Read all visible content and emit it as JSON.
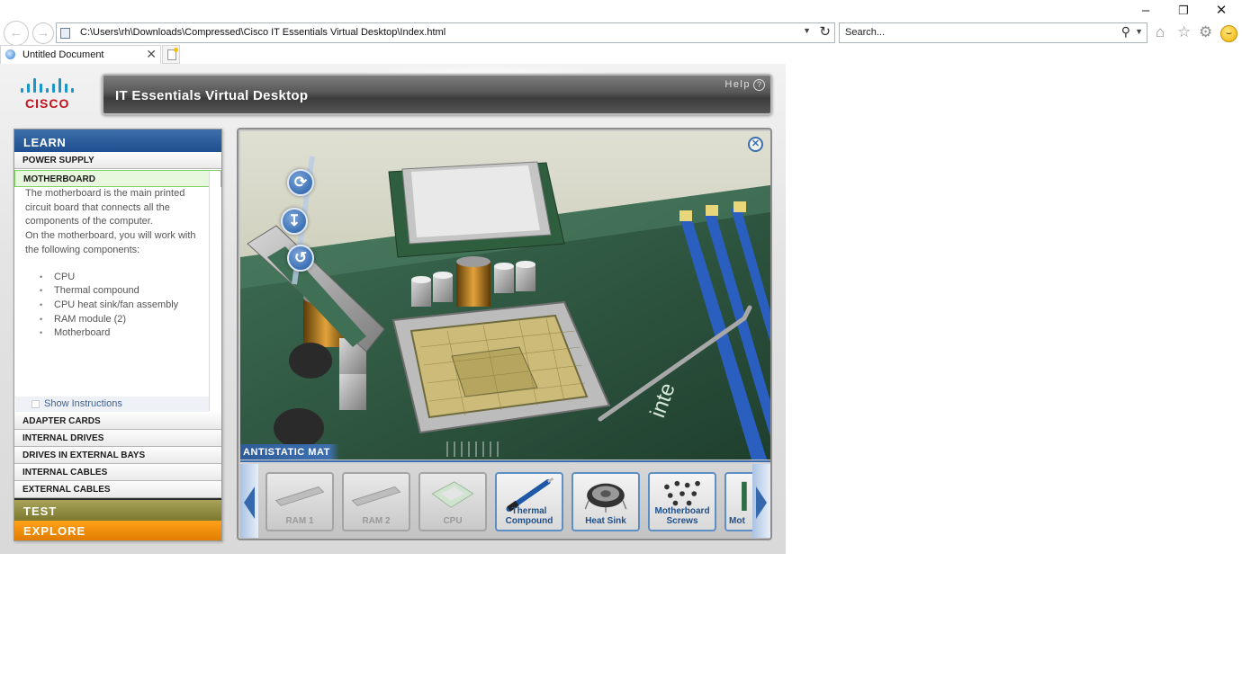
{
  "browser": {
    "address": "C:\\Users\\rh\\Downloads\\Compressed\\Cisco IT Essentials Virtual Desktop\\Index.html",
    "search_placeholder": "Search...",
    "tab_title": "Untitled Document"
  },
  "app": {
    "logo_text": "CISCO",
    "title": "IT Essentials Virtual Desktop",
    "help": "Help"
  },
  "menu": {
    "learn": "LEARN",
    "items_top": [
      "POWER SUPPLY",
      "MOTHERBOARD"
    ],
    "description": [
      "The motherboard is the main printed",
      "circuit board that connects all the",
      "components of the computer.",
      "On the motherboard, you will work with",
      "the following components:"
    ],
    "components": [
      "CPU",
      "Thermal compound",
      "CPU heat sink/fan assembly",
      "RAM module (2)",
      "Motherboard"
    ],
    "show_instructions": "Show Instructions",
    "items_bottom": [
      "ADAPTER CARDS",
      "INTERNAL DRIVES",
      "DRIVES IN EXTERNAL BAYS",
      "INTERNAL CABLES",
      "EXTERNAL CABLES"
    ],
    "test": "TEST",
    "explore": "EXPLORE"
  },
  "stage": {
    "mat_label": "ANTISTATIC MAT",
    "tray_items": [
      {
        "line1": "",
        "line2": "RAM 1",
        "enabled": false
      },
      {
        "line1": "",
        "line2": "RAM 2",
        "enabled": false
      },
      {
        "line1": "",
        "line2": "CPU",
        "enabled": false
      },
      {
        "line1": "Thermal",
        "line2": "Compound",
        "enabled": true
      },
      {
        "line1": "",
        "line2": "Heat Sink",
        "enabled": true
      },
      {
        "line1": "Motherboard",
        "line2": "Screws",
        "enabled": true
      },
      {
        "line1": "",
        "line2": "Mot",
        "enabled": true
      }
    ]
  },
  "colors": {
    "accent_blue": "#1f4f8e",
    "active_green": "#e7f8df",
    "test_olive": "#7b782f",
    "explore_orange": "#e17d00",
    "cisco_red": "#c4111b"
  }
}
